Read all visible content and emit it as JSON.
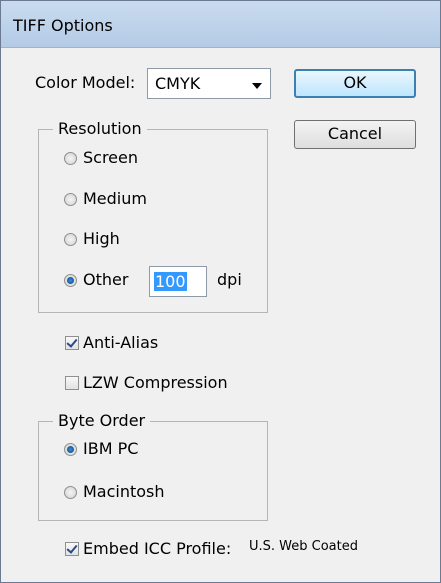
{
  "window": {
    "title": "TIFF Options"
  },
  "color_model": {
    "label": "Color Model:",
    "value": "CMYK"
  },
  "buttons": {
    "ok": "OK",
    "cancel": "Cancel"
  },
  "resolution": {
    "legend": "Resolution",
    "options": [
      "Screen",
      "Medium",
      "High",
      "Other"
    ],
    "selected": "Other",
    "other_value": "100",
    "unit": "dpi"
  },
  "anti_alias": {
    "label": "Anti-Alias",
    "checked": true
  },
  "lzw": {
    "label": "LZW Compression",
    "checked": false
  },
  "byte_order": {
    "legend": "Byte Order",
    "options": [
      "IBM PC",
      "Macintosh"
    ],
    "selected": "IBM PC"
  },
  "icc": {
    "label": "Embed ICC Profile:",
    "checked": true,
    "profile": "U.S. Web Coated"
  },
  "colors": {
    "accent": "#3c7fb1",
    "selection": "#3399ff",
    "titlebar": "#c9dbef"
  }
}
